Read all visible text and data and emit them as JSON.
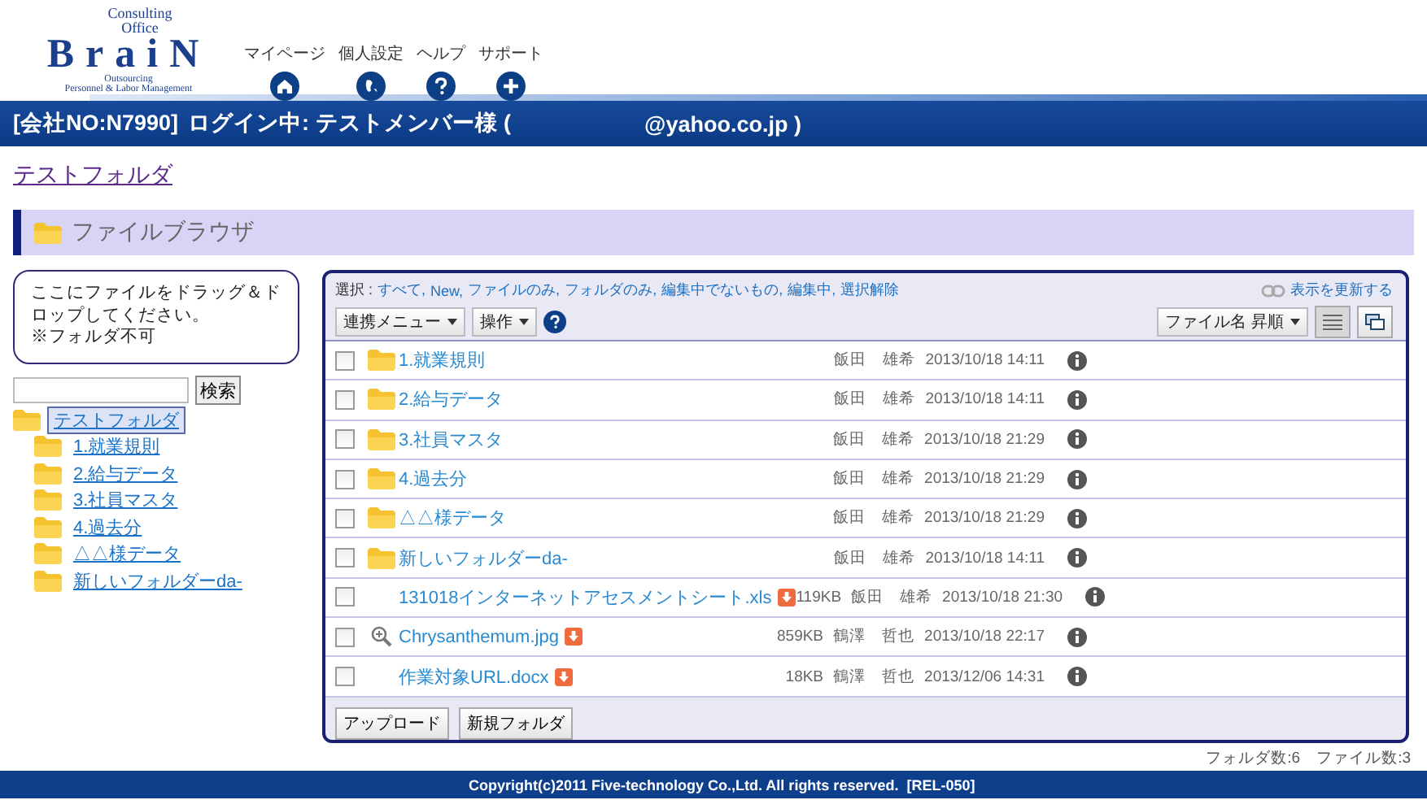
{
  "logo": {
    "line_1": "Consulting",
    "line_2": "Office",
    "name": "BraiN",
    "line_3": "Outsourcing",
    "line_4": "Personnel & Labor Management"
  },
  "nav": [
    {
      "label": "マイページ",
      "kind": "home"
    },
    {
      "label": "個人設定",
      "kind": "globe"
    },
    {
      "label": "ヘルプ",
      "kind": "help"
    },
    {
      "label": "サポート",
      "kind": "plus"
    }
  ],
  "login_bar": {
    "company": "[会社NO:N7990]",
    "status": "ログイン中: テストメンバー様 (",
    "email": "@yahoo.co.jp )"
  },
  "breadcrumb": "テストフォルダ",
  "section_title": "ファイルブラウザ",
  "drop_zone": {
    "text": "ここにファイルをドラッグ＆ドロップしてください。",
    "note": "※フォルダ不可"
  },
  "search": {
    "button": "検索"
  },
  "tree": [
    {
      "label": "テストフォルダ",
      "selected": true,
      "children": [
        {
          "label": "1.就業規則",
          "selected": false
        },
        {
          "label": "2.給与データ",
          "selected": false
        },
        {
          "label": "3.社員マスタ",
          "selected": false
        },
        {
          "label": "4.過去分",
          "selected": false
        },
        {
          "label": "△△様データ",
          "selected": false
        },
        {
          "label": "新しいフォルダーda-",
          "selected": false
        }
      ]
    }
  ],
  "browser": {
    "select_label": "選択 :",
    "select_links": [
      "すべて,",
      "New,",
      "ファイルのみ,",
      "フォルダのみ,",
      "編集中でないもの,",
      "編集中,",
      "選択解除"
    ],
    "refresh": "表示を更新する",
    "menus": [
      "連携メニュー",
      "操作"
    ],
    "sort": "ファイル名 昇順",
    "rows": [
      {
        "kind": "folder",
        "name": "1.就業規則",
        "owner": "飯田　雄希",
        "date": "2013/10/18 14:11",
        "checked": false
      },
      {
        "kind": "folder",
        "name": "2.給与データ",
        "owner": "飯田　雄希",
        "date": "2013/10/18 14:11",
        "checked": false
      },
      {
        "kind": "folder",
        "name": "3.社員マスタ",
        "owner": "飯田　雄希",
        "date": "2013/10/18 21:29",
        "checked": false
      },
      {
        "kind": "folder",
        "name": "4.過去分",
        "owner": "飯田　雄希",
        "date": "2013/10/18 21:29",
        "checked": false
      },
      {
        "kind": "folder",
        "name": "△△様データ",
        "owner": "飯田　雄希",
        "date": "2013/10/18 21:29",
        "checked": false
      },
      {
        "kind": "folder",
        "name": "新しいフォルダーda-",
        "owner": "飯田　雄希",
        "date": "2013/10/18 14:11",
        "checked": false
      },
      {
        "kind": "file",
        "name": "131018インターネットアセスメントシート.xls",
        "size": "119KB",
        "owner": "飯田　雄希",
        "date": "2013/10/18 21:30",
        "checked": false
      },
      {
        "kind": "image",
        "name": "Chrysanthemum.jpg",
        "size": "859KB",
        "owner": "鶴澤　哲也",
        "date": "2013/10/18 22:17",
        "checked": false
      },
      {
        "kind": "file",
        "name": "作業対象URL.docx",
        "size": "18KB",
        "owner": "鶴澤　哲也",
        "date": "2013/12/06 14:31",
        "checked": false
      }
    ],
    "buttons": [
      "アップロード",
      "新規フォルダ"
    ]
  },
  "counts": "フォルダ数:6　ファイル数:3",
  "footer": "Copyright(c)2011 Five-technology Co.,Ltd. All rights reserved.  [REL-050]"
}
